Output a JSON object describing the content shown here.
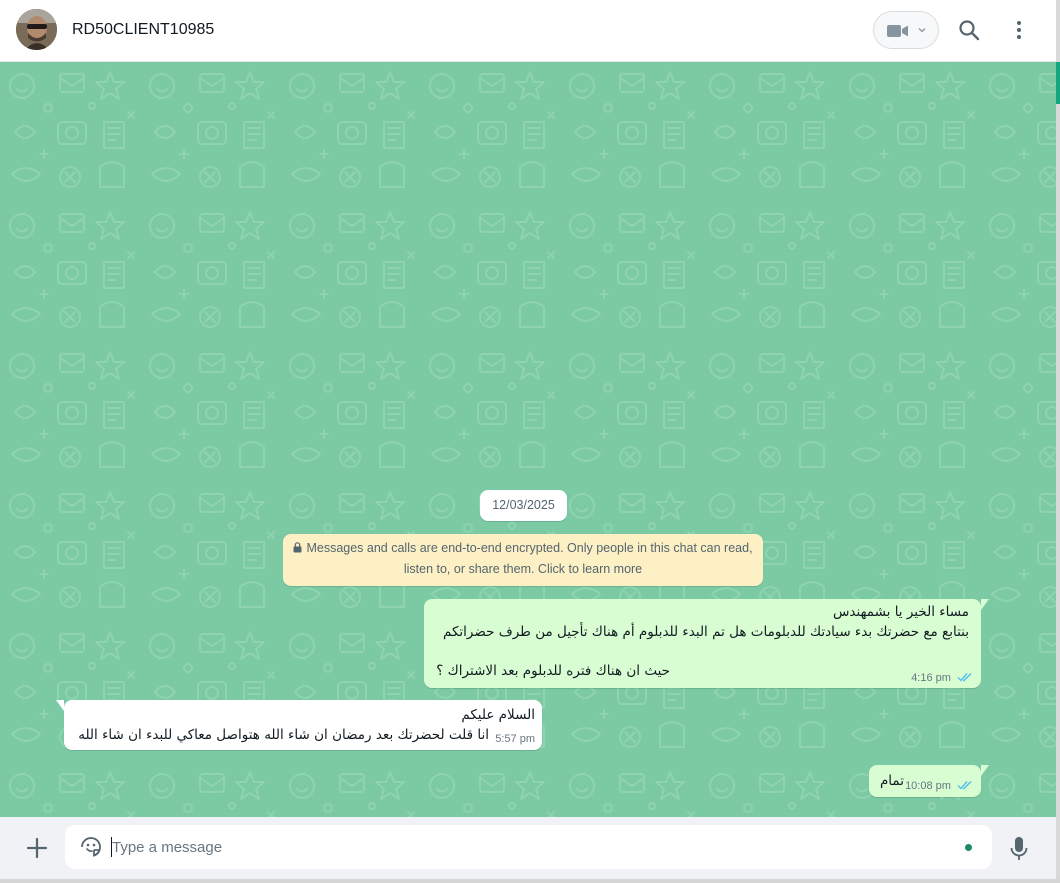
{
  "header": {
    "contact_name": "RD50CLIENT10985"
  },
  "chat": {
    "date_chip": "12/03/2025",
    "encryption_line1": "Messages and calls are end-to-end encrypted. Only people in this chat can read,",
    "encryption_line2": "listen to, or share them. Click to learn more",
    "messages": [
      {
        "direction": "outgoing",
        "lines": [
          "مساء الخير يا بشمهندس",
          "بنتابع مع حضرتك بدء سيادتك للدبلومات هل تم البدء للدبلوم أم هناك تأجيل من طرف حضراتكم",
          "حيث ان هناك فتره للدبلوم بعد الاشتراك ؟"
        ],
        "time": "4:16 pm",
        "status": "read"
      },
      {
        "direction": "incoming",
        "lines": [
          "السلام عليكم",
          "انا قلت لحضرتك بعد رمضان ان شاء الله هتواصل معاكي للبدء ان شاء الله"
        ],
        "time": "5:57 pm"
      },
      {
        "direction": "outgoing",
        "lines": [
          "تمام"
        ],
        "time": "10:08 pm",
        "status": "read"
      }
    ]
  },
  "composer": {
    "placeholder": "Type a message"
  },
  "colors": {
    "chat_background": "#7bcaa3",
    "outgoing_bubble": "#d9fdd3",
    "incoming_bubble": "#ffffff",
    "read_ticks": "#53bdeb",
    "accent": "#13a77f"
  },
  "icons": {
    "video": "video-camera-icon",
    "search": "search-icon",
    "menu": "kebab-menu-icon",
    "attach": "plus-icon",
    "emoji": "sticker-emoji-icon",
    "mic": "microphone-icon",
    "lock": "lock-icon",
    "ticks": "double-check-icon"
  }
}
